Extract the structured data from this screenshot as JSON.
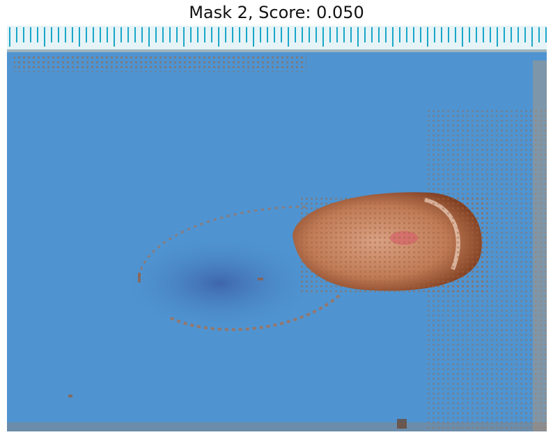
{
  "figure": {
    "title": "Mask 2, Score: 0.050"
  },
  "image": {
    "subject": "photograph of a skin lesion on a finger/toe with a blue segmentation mask overlay and a measuring ruler at the top",
    "mask_color": "#4f94d1",
    "ruler_color": "#1aa6c8",
    "skin_tone": "#c98a68"
  }
}
